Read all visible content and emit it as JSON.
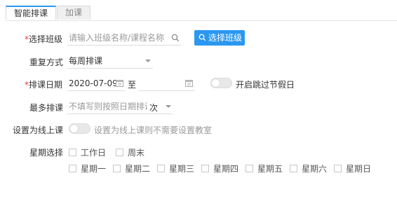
{
  "tabs": [
    {
      "label": "智能排课",
      "active": true
    },
    {
      "label": "加课",
      "active": false
    }
  ],
  "form": {
    "class_select": {
      "label": "选择班级",
      "required_mark": "*",
      "placeholder": "请输入班级名称/课程名称",
      "button_label": "选择班级"
    },
    "repeat_mode": {
      "label": "重复方式",
      "value": "每周排课"
    },
    "schedule_date": {
      "label": "排课日期",
      "required_mark": "*",
      "start_value": "2020-07-09",
      "separator": "至",
      "end_value": "",
      "skip_holidays_label": "开启跳过节假日",
      "skip_holidays_on": false
    },
    "max_schedule": {
      "label": "最多排课",
      "placeholder": "不填写则按照日期排课",
      "unit": "次"
    },
    "online_class": {
      "label": "设置为线上课",
      "toggle_on": false,
      "hint": "设置为线上课则不需要设置教室"
    },
    "weekday_select": {
      "label": "星期选择",
      "quick_options": [
        "工作日",
        "周末"
      ],
      "days": [
        "星期一",
        "星期二",
        "星期三",
        "星期四",
        "星期五",
        "星期六",
        "星期日"
      ]
    }
  },
  "colors": {
    "accent": "#2b97f0",
    "required": "#e4393c"
  },
  "icons": {
    "search": "search-icon",
    "calendar": "calendar-icon",
    "dropdown": "chevron-down-icon"
  }
}
